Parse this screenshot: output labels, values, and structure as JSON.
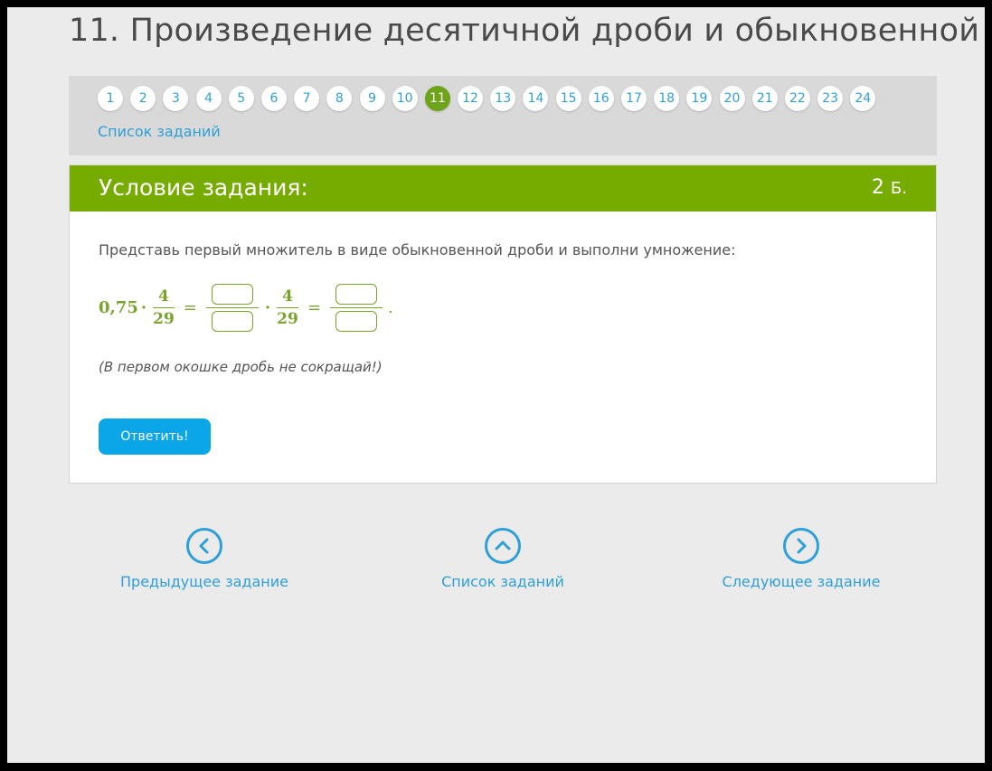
{
  "page_title": "11. Произведение десятичной дроби и обыкновенной",
  "pager": {
    "pages": [
      "1",
      "2",
      "3",
      "4",
      "5",
      "6",
      "7",
      "8",
      "9",
      "10",
      "11",
      "12",
      "13",
      "14",
      "15",
      "16",
      "17",
      "18",
      "19",
      "20",
      "21",
      "22",
      "23",
      "24"
    ],
    "active": "11",
    "list_link": "Список заданий"
  },
  "task": {
    "title": "Условие задания:",
    "score": "2",
    "score_unit": "Б.",
    "instruction": "Представь первый множитель в виде обыкновенной дроби и выполни умножение:",
    "formula": {
      "decimal": "0,75",
      "dot": "·",
      "equals": "=",
      "numerator": "4",
      "denominator": "29",
      "period": "."
    },
    "note": "(В первом окошке дробь не сокращай!)",
    "submit_label": "Ответить!"
  },
  "navigation": {
    "prev_label": "Предыдущее задание",
    "list_label": "Список заданий",
    "next_label": "Следующее задание"
  },
  "colors": {
    "accent_green": "#76ab00",
    "link_blue": "#2f9fd7",
    "button_blue": "#0aa6e8"
  }
}
